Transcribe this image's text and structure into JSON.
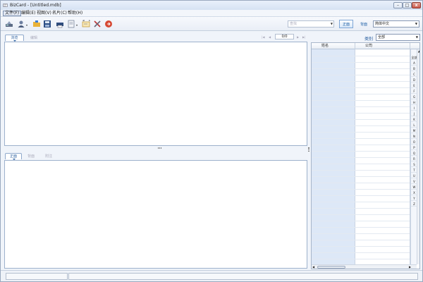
{
  "window": {
    "title": "BizCard - [Untitled.mdb]"
  },
  "menu": {
    "items": [
      {
        "label": "文件(F)"
      },
      {
        "label": "编辑(E)"
      },
      {
        "label": "视图(V)"
      },
      {
        "label": "名片(C)"
      },
      {
        "label": "帮助(H)"
      }
    ]
  },
  "toolbar": {
    "search_placeholder": "查找",
    "front_label": "正面",
    "back_label": "背面",
    "language": "简体中文"
  },
  "preview": {
    "tabs": [
      {
        "label": "浏览"
      },
      {
        "label": "编辑"
      }
    ],
    "page_indicator": "0/0"
  },
  "detail": {
    "tabs": [
      {
        "label": "正面"
      },
      {
        "label": "背面"
      },
      {
        "label": "附注"
      }
    ]
  },
  "category": {
    "label": "类别",
    "selected": "全部"
  },
  "grid": {
    "columns": [
      "姓名",
      "公司"
    ],
    "index_letters": [
      "全部",
      "A",
      "B",
      "C",
      "D",
      "E",
      "F",
      "G",
      "H",
      "I",
      "J",
      "K",
      "L",
      "M",
      "N",
      "O",
      "P",
      "Q",
      "R",
      "S",
      "T",
      "U",
      "V",
      "W",
      "X",
      "Y",
      "Z"
    ]
  },
  "icons": {
    "close": "close-icon",
    "minimize": "minimize-icon",
    "maximize": "maximize-icon"
  },
  "colors": {
    "accent": "#2a5fa0",
    "name_column": "#dde8f7"
  }
}
